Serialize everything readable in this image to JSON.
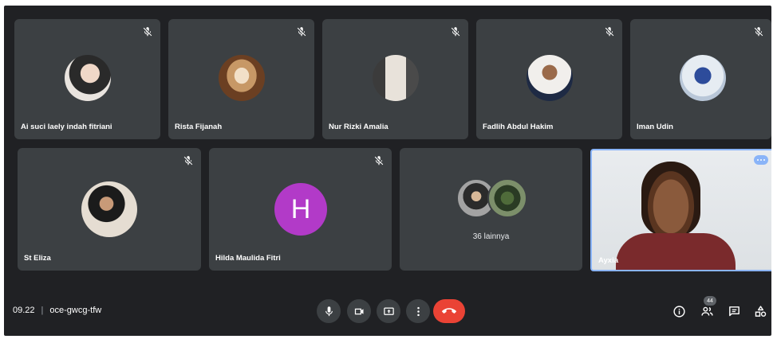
{
  "meeting": {
    "time": "09.22",
    "code": "oce-gwcg-tfw"
  },
  "participants_top": [
    {
      "name": "Ai suci laely indah fitriani",
      "muted": true
    },
    {
      "name": "Rista Fijanah",
      "muted": true
    },
    {
      "name": "Nur Rizki Amalia",
      "muted": true
    },
    {
      "name": "Fadlih Abdul Hakim",
      "muted": true
    },
    {
      "name": "Iman Udin",
      "muted": true
    }
  ],
  "participants_bottom": [
    {
      "name": "St Eliza",
      "muted": true
    },
    {
      "name": "Hilda Maulida Fitri",
      "muted": true,
      "initial": "H"
    }
  ],
  "others": {
    "label": "36 lainnya"
  },
  "self": {
    "name": "Ayxia"
  },
  "people_count": "44",
  "colors": {
    "background": "#202124",
    "tile": "#3c4043",
    "hangup": "#ea4335",
    "active_border": "#8ab4f8",
    "avatar_letter": "#b23ac8"
  },
  "icons": {
    "mic": "mic-icon",
    "camera": "camera-icon",
    "present": "present-screen-icon",
    "more": "more-vert-icon",
    "hangup": "hangup-icon",
    "info": "info-icon",
    "people": "people-icon",
    "chat": "chat-icon",
    "activities": "activities-icon",
    "muted": "mic-off-icon"
  }
}
